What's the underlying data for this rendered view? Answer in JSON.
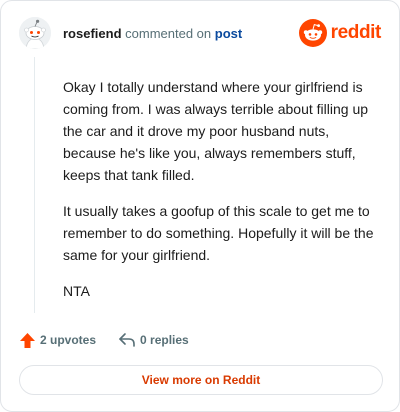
{
  "header": {
    "username": "rosefiend",
    "action_text": "commented on",
    "post_link": "post",
    "brand_name": "reddit"
  },
  "comment": {
    "paragraphs": [
      "Okay I totally understand where your girlfriend is coming from. I was always terrible about filling up the car and it drove my poor husband nuts, because he's like you, always remembers stuff, keeps that tank filled.",
      "It usually takes a goofup of this scale to get me to remember to do something. Hopefully it will be the same for your girlfriend.",
      "NTA"
    ]
  },
  "actions": {
    "upvotes": "2 upvotes",
    "replies": "0 replies"
  },
  "footer": {
    "view_more_label": "View more on Reddit"
  },
  "colors": {
    "brand": "#ff4500",
    "link": "#0a4a9e",
    "muted": "#576f76",
    "cta_text": "#d93a00"
  },
  "icons": {
    "avatar": "snoo-avatar-icon",
    "brand": "reddit-logo-icon",
    "upvote": "upvote-arrow-icon",
    "reply": "reply-arrow-icon"
  }
}
